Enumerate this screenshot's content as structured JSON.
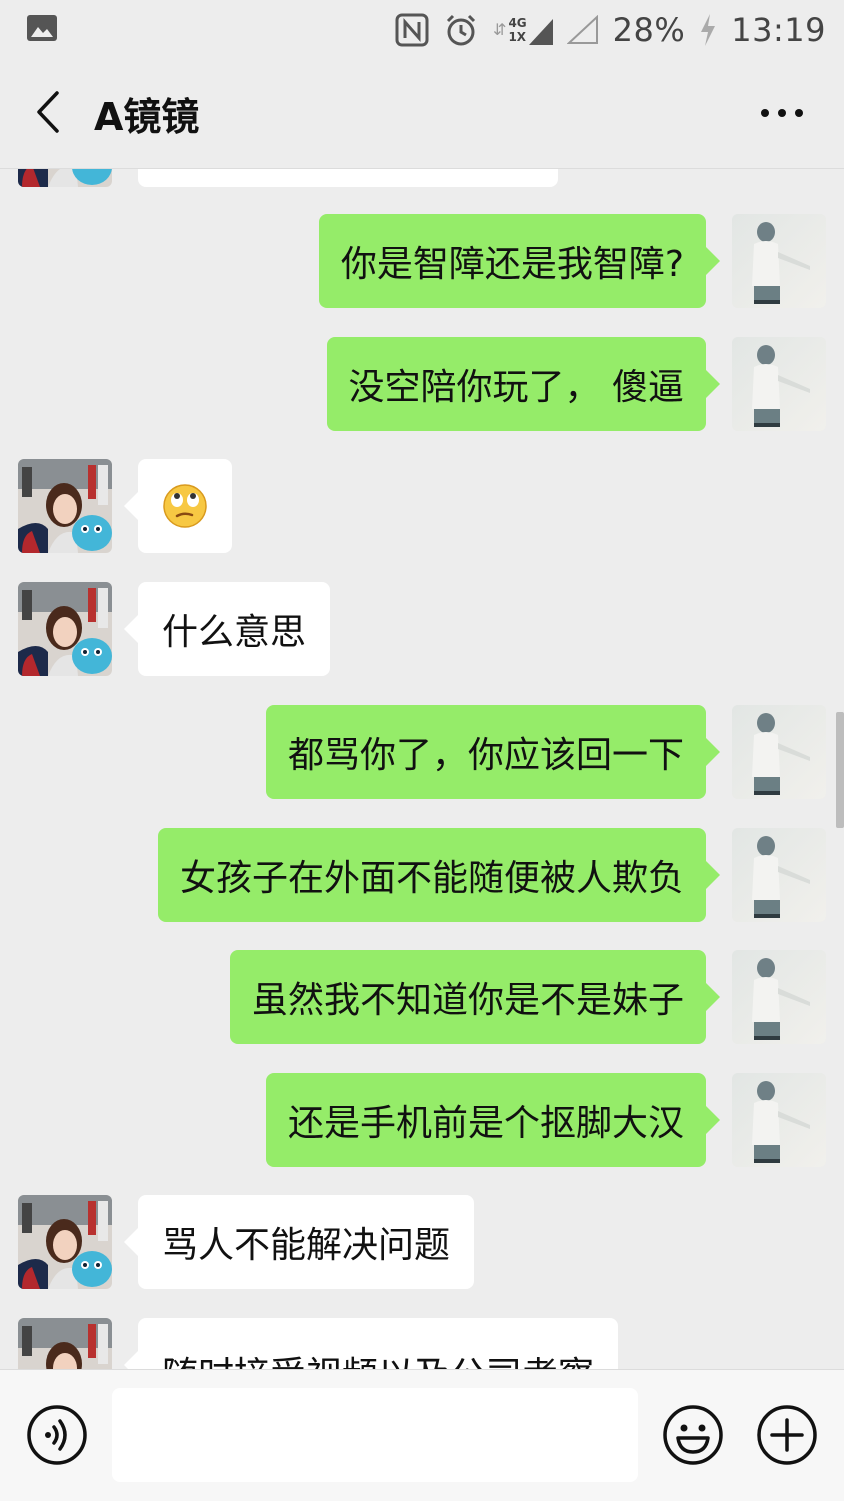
{
  "status_bar": {
    "network": "4G",
    "network2": "1X",
    "battery": "28%",
    "time": "13:19"
  },
  "header": {
    "title": "A镜镜"
  },
  "messages": [
    {
      "from": "them",
      "text": "",
      "partial": true
    },
    {
      "from": "me",
      "text": "你是智障还是我智障?"
    },
    {
      "from": "me",
      "text": "没空陪你玩了， 傻逼"
    },
    {
      "from": "them",
      "text": "🙄",
      "emoji": "eye-roll-emoji"
    },
    {
      "from": "them",
      "text": "什么意思"
    },
    {
      "from": "me",
      "text": "都骂你了，你应该回一下"
    },
    {
      "from": "me",
      "text": "女孩子在外面不能随便被人欺负"
    },
    {
      "from": "me",
      "text": "虽然我不知道你是不是妹子"
    },
    {
      "from": "me",
      "text": "还是手机前是个抠脚大汉"
    },
    {
      "from": "them",
      "text": "骂人不能解决问题"
    },
    {
      "from": "them",
      "text": "随时接受视频以及公司考察",
      "partial": true
    }
  ],
  "input": {
    "placeholder": "",
    "value": ""
  },
  "colors": {
    "outgoing_bubble": "#95ec69",
    "incoming_bubble": "#ffffff",
    "background": "#ededed"
  }
}
